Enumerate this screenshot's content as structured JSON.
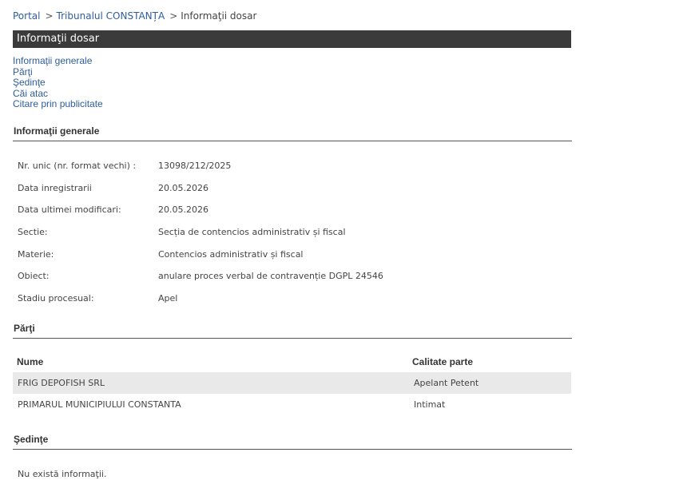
{
  "breadcrumb": {
    "portal": "Portal",
    "court": "Tribunalul CONSTANȚA",
    "current": "Informaţii dosar",
    "separator": ">"
  },
  "title": "Informaţii dosar",
  "quick_nav": {
    "items": [
      "Informaţii generale",
      "Părţi",
      "Şedinţe",
      "Căi atac",
      "Citare prin publicitate"
    ]
  },
  "general": {
    "heading": "Informaţii generale",
    "rows": [
      {
        "label": "Nr. unic (nr. format vechi) :",
        "value": "13098/212/2025"
      },
      {
        "label": "Data inregistrarii",
        "value": "20.05.2026"
      },
      {
        "label": "Data ultimei modificari:",
        "value": "20.05.2026"
      },
      {
        "label": "Sectie:",
        "value": "Secția de contencios administrativ și fiscal"
      },
      {
        "label": "Materie:",
        "value": "Contencios administrativ și fiscal"
      },
      {
        "label": "Obiect:",
        "value": "anulare proces verbal de contravenție DGPL 24546"
      },
      {
        "label": "Stadiu procesual:",
        "value": "Apel"
      }
    ]
  },
  "parties": {
    "heading": "Părţi",
    "columns": {
      "name": "Nume",
      "role": "Calitate parte"
    },
    "rows": [
      {
        "name": "FRIG DEPOFISH SRL",
        "role": "Apelant Petent"
      },
      {
        "name": "PRIMARUL MUNICIPIULUI CONSTANTA",
        "role": "Intimat"
      }
    ]
  },
  "hearings": {
    "heading": "Şedinţe",
    "empty_text": "Nu există informaţii."
  },
  "colors": {
    "link": "#2e5d9e",
    "title_bar_bg": "#3b3b3b",
    "shaded_row": "#e9e9e9"
  }
}
